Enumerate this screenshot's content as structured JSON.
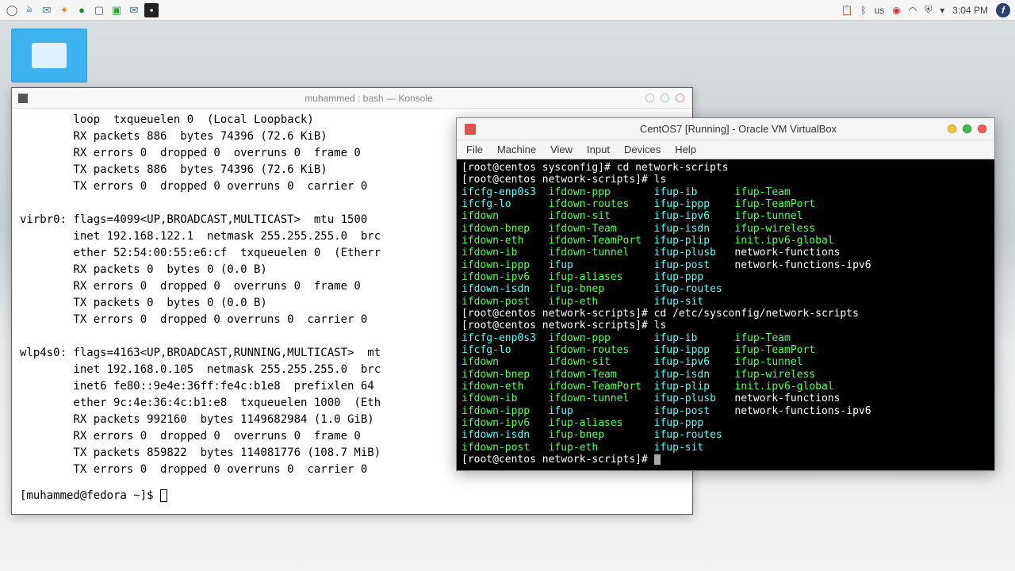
{
  "panel": {
    "right": {
      "kbd": "us",
      "time": "3:04 PM"
    }
  },
  "konsole": {
    "title": "muhammed : bash — Konsole",
    "lines": [
      "        loop  txqueuelen 0  (Local Loopback)",
      "        RX packets 886  bytes 74396 (72.6 KiB)",
      "        RX errors 0  dropped 0  overruns 0  frame 0",
      "        TX packets 886  bytes 74396 (72.6 KiB)",
      "        TX errors 0  dropped 0 overruns 0  carrier 0",
      "",
      "virbr0: flags=4099<UP,BROADCAST,MULTICAST>  mtu 1500",
      "        inet 192.168.122.1  netmask 255.255.255.0  brc",
      "        ether 52:54:00:55:e6:cf  txqueuelen 0  (Etherr",
      "        RX packets 0  bytes 0 (0.0 B)",
      "        RX errors 0  dropped 0  overruns 0  frame 0",
      "        TX packets 0  bytes 0 (0.0 B)",
      "        TX errors 0  dropped 0 overruns 0  carrier 0",
      "",
      "wlp4s0: flags=4163<UP,BROADCAST,RUNNING,MULTICAST>  mt",
      "        inet 192.168.0.105  netmask 255.255.255.0  brc",
      "        inet6 fe80::9e4e:36ff:fe4c:b1e8  prefixlen 64",
      "        ether 9c:4e:36:4c:b1:e8  txqueuelen 1000  (Eth",
      "        RX packets 992160  bytes 1149682984 (1.0 GiB)",
      "        RX errors 0  dropped 0  overruns 0  frame 0",
      "        TX packets 859822  bytes 114081776 (108.7 MiB)",
      "        TX errors 0  dropped 0 overruns 0  carrier 0"
    ],
    "prompt": "[muhammed@fedora ~]$ "
  },
  "vbox": {
    "title": "CentOS7 [Running] - Oracle VM VirtualBox",
    "menus": [
      "File",
      "Machine",
      "View",
      "Input",
      "Devices",
      "Help"
    ],
    "lines": [
      [
        [
          "w",
          "[root@centos sysconfig]# cd network-scripts"
        ]
      ],
      [
        [
          "w",
          "[root@centos network-scripts]# ls"
        ]
      ],
      [
        [
          "c",
          "ifcfg-enp0s3  "
        ],
        [
          "g",
          "ifdown-ppp       "
        ],
        [
          "c",
          "ifup-ib      "
        ],
        [
          "g",
          "ifup-Team"
        ]
      ],
      [
        [
          "c",
          "ifcfg-lo      "
        ],
        [
          "g",
          "ifdown-routes    "
        ],
        [
          "c",
          "ifup-ippp    "
        ],
        [
          "g",
          "ifup-TeamPort"
        ]
      ],
      [
        [
          "g",
          "ifdown        "
        ],
        [
          "g",
          "ifdown-sit       "
        ],
        [
          "c",
          "ifup-ipv6    "
        ],
        [
          "g",
          "ifup-tunnel"
        ]
      ],
      [
        [
          "g",
          "ifdown-bnep   "
        ],
        [
          "g",
          "ifdown-Team      "
        ],
        [
          "c",
          "ifup-isdn    "
        ],
        [
          "g",
          "ifup-wireless"
        ]
      ],
      [
        [
          "g",
          "ifdown-eth    "
        ],
        [
          "g",
          "ifdown-TeamPort  "
        ],
        [
          "c",
          "ifup-plip    "
        ],
        [
          "g",
          "init.ipv6-global"
        ]
      ],
      [
        [
          "g",
          "ifdown-ib     "
        ],
        [
          "g",
          "ifdown-tunnel    "
        ],
        [
          "c",
          "ifup-plusb   "
        ],
        [
          "w",
          "network-functions"
        ]
      ],
      [
        [
          "g",
          "ifdown-ippp   "
        ],
        [
          "c",
          "ifup             "
        ],
        [
          "c",
          "ifup-post    "
        ],
        [
          "w",
          "network-functions-ipv6"
        ]
      ],
      [
        [
          "g",
          "ifdown-ipv6   "
        ],
        [
          "g",
          "ifup-aliases     "
        ],
        [
          "c",
          "ifup-ppp"
        ]
      ],
      [
        [
          "c",
          "ifdown-isdn   "
        ],
        [
          "g",
          "ifup-bnep        "
        ],
        [
          "c",
          "ifup-routes"
        ]
      ],
      [
        [
          "g",
          "ifdown-post   "
        ],
        [
          "g",
          "ifup-eth         "
        ],
        [
          "c",
          "ifup-sit"
        ]
      ],
      [
        [
          "w",
          "[root@centos network-scripts]# cd /etc/sysconfig/network-scripts"
        ]
      ],
      [
        [
          "w",
          "[root@centos network-scripts]# ls"
        ]
      ],
      [
        [
          "c",
          "ifcfg-enp0s3  "
        ],
        [
          "g",
          "ifdown-ppp       "
        ],
        [
          "c",
          "ifup-ib      "
        ],
        [
          "g",
          "ifup-Team"
        ]
      ],
      [
        [
          "c",
          "ifcfg-lo      "
        ],
        [
          "g",
          "ifdown-routes    "
        ],
        [
          "c",
          "ifup-ippp    "
        ],
        [
          "g",
          "ifup-TeamPort"
        ]
      ],
      [
        [
          "g",
          "ifdown        "
        ],
        [
          "g",
          "ifdown-sit       "
        ],
        [
          "c",
          "ifup-ipv6    "
        ],
        [
          "g",
          "ifup-tunnel"
        ]
      ],
      [
        [
          "g",
          "ifdown-bnep   "
        ],
        [
          "g",
          "ifdown-Team      "
        ],
        [
          "c",
          "ifup-isdn    "
        ],
        [
          "g",
          "ifup-wireless"
        ]
      ],
      [
        [
          "g",
          "ifdown-eth    "
        ],
        [
          "g",
          "ifdown-TeamPort  "
        ],
        [
          "c",
          "ifup-plip    "
        ],
        [
          "g",
          "init.ipv6-global"
        ]
      ],
      [
        [
          "g",
          "ifdown-ib     "
        ],
        [
          "g",
          "ifdown-tunnel    "
        ],
        [
          "c",
          "ifup-plusb   "
        ],
        [
          "w",
          "network-functions"
        ]
      ],
      [
        [
          "g",
          "ifdown-ippp   "
        ],
        [
          "c",
          "ifup             "
        ],
        [
          "c",
          "ifup-post    "
        ],
        [
          "w",
          "network-functions-ipv6"
        ]
      ],
      [
        [
          "g",
          "ifdown-ipv6   "
        ],
        [
          "g",
          "ifup-aliases     "
        ],
        [
          "c",
          "ifup-ppp"
        ]
      ],
      [
        [
          "c",
          "ifdown-isdn   "
        ],
        [
          "g",
          "ifup-bnep        "
        ],
        [
          "c",
          "ifup-routes"
        ]
      ],
      [
        [
          "g",
          "ifdown-post   "
        ],
        [
          "g",
          "ifup-eth         "
        ],
        [
          "c",
          "ifup-sit"
        ]
      ]
    ],
    "prompt": "[root@centos network-scripts]# "
  }
}
